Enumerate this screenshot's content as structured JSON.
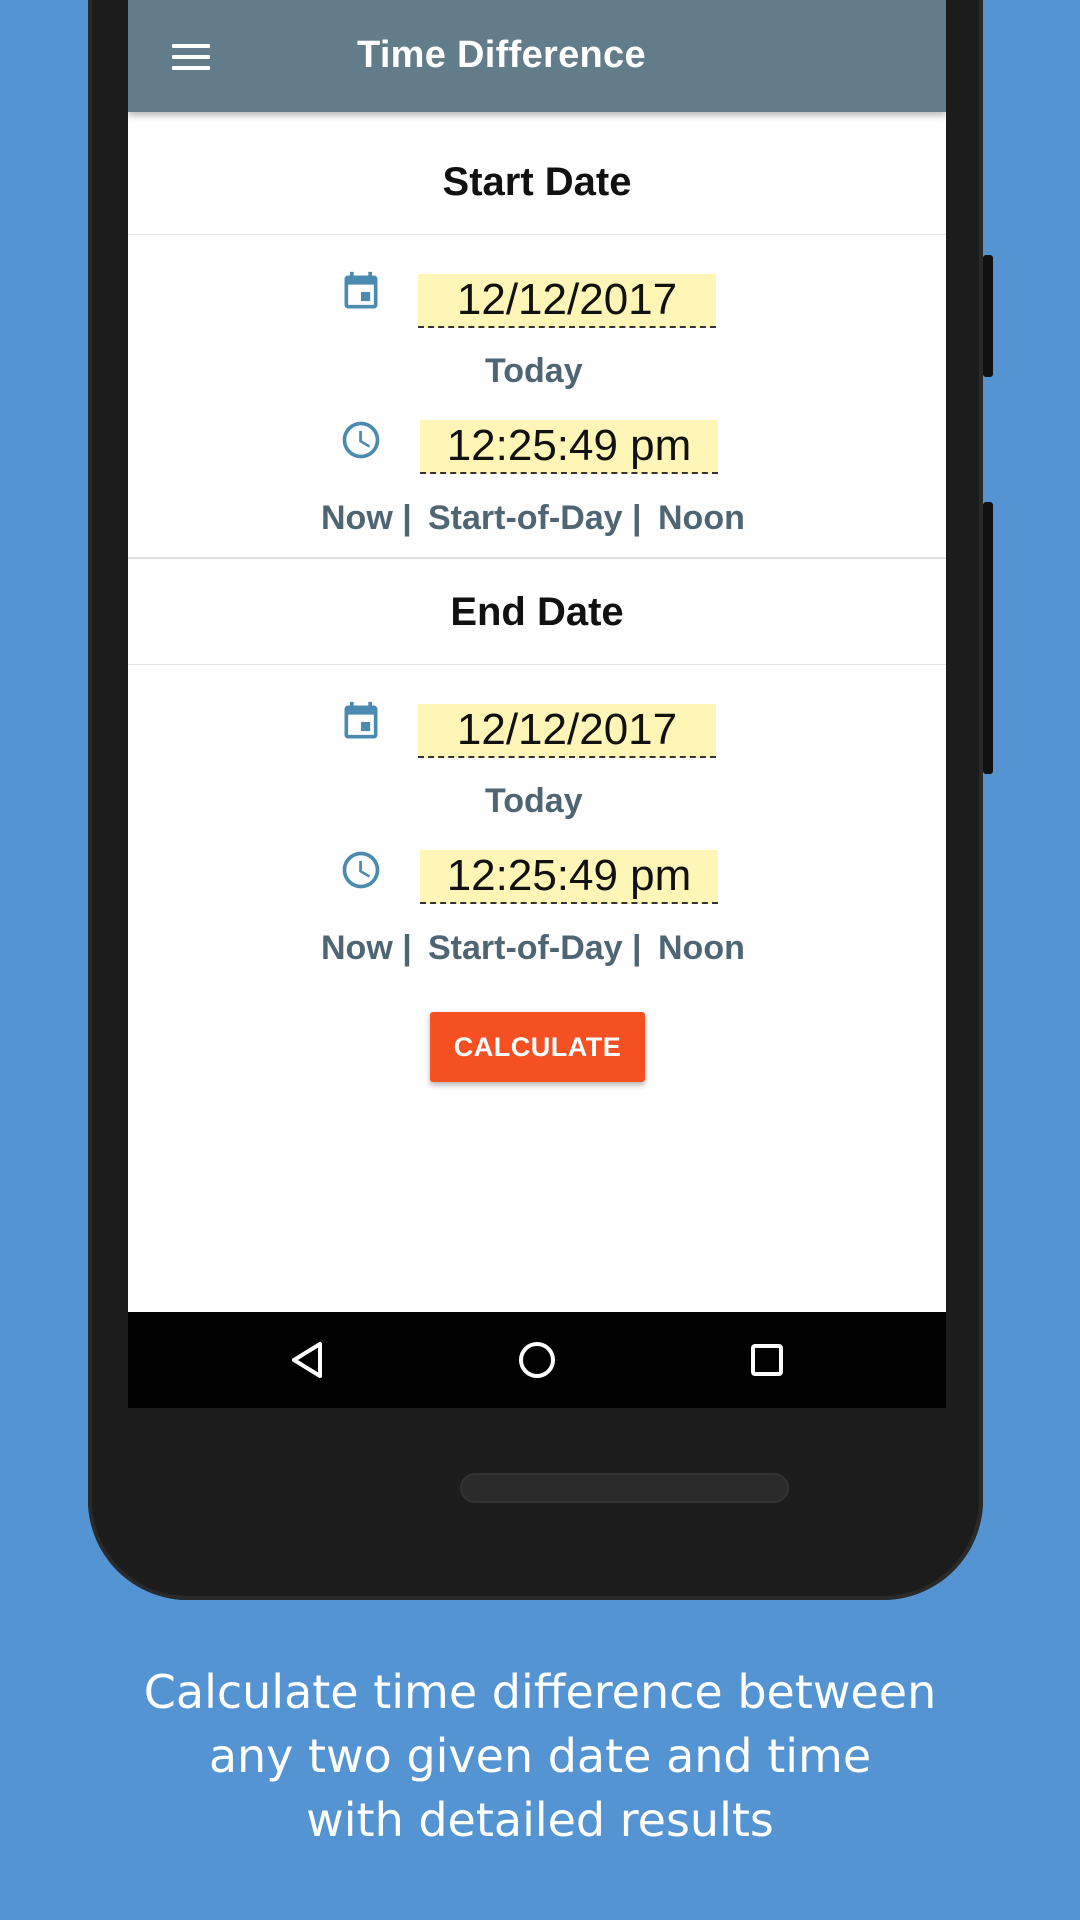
{
  "app": {
    "title": "Time Difference"
  },
  "start": {
    "heading": "Start Date",
    "date_value": "12/12/2017",
    "today_label": "Today",
    "time_value": "12:25:49 pm",
    "links": [
      "Now |",
      "Start-of-Day |",
      "Noon"
    ]
  },
  "end": {
    "heading": "End Date",
    "date_value": "12/12/2017",
    "today_label": "Today",
    "time_value": "12:25:49 pm",
    "links": [
      "Now |",
      "Start-of-Day |",
      "Noon"
    ]
  },
  "calculate_label": "CALCULATE",
  "icons": {
    "menu": "menu-icon",
    "date": "calendar-icon",
    "time": "clock-icon",
    "nav_back": "back-triangle-icon",
    "nav_home": "home-circle-icon",
    "nav_recents": "recents-square-icon"
  },
  "colors": {
    "background": "#5594d2",
    "appbar": "#637c89",
    "field_highlight": "#fff5b7",
    "link_text": "#4e6674",
    "icon_accent": "#4b8bb1",
    "calculate_button": "#f55022"
  },
  "caption": {
    "lines": [
      "Calculate time difference between",
      "any two given date and time",
      "with detailed results"
    ]
  }
}
